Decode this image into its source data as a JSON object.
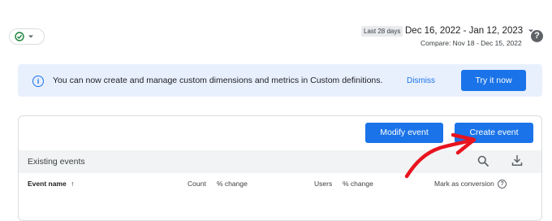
{
  "status_chip": {
    "icon": "check-circle-icon",
    "dropdown_icon": "caret-down-icon"
  },
  "date": {
    "badge": "Last 28 days",
    "range": "Dec 16, 2022 - Jan 12, 2023",
    "compare": "Compare: Nov 18 - Dec 15, 2022"
  },
  "help": {
    "label": "?"
  },
  "banner": {
    "message": "You can now create and manage custom dimensions and metrics in Custom definitions.",
    "dismiss": "Dismiss",
    "cta": "Try it now"
  },
  "actions": {
    "modify": "Modify event",
    "create": "Create event"
  },
  "table": {
    "title": "Existing events",
    "columns": {
      "event_name": "Event name",
      "count": "Count",
      "count_change": "% change",
      "users": "Users",
      "users_change": "% change",
      "conversion": "Mark as conversion"
    }
  },
  "colors": {
    "primary": "#1a73e8",
    "banner_bg": "#e8f0fe",
    "annotation": "#e8141e",
    "success": "#188038"
  }
}
